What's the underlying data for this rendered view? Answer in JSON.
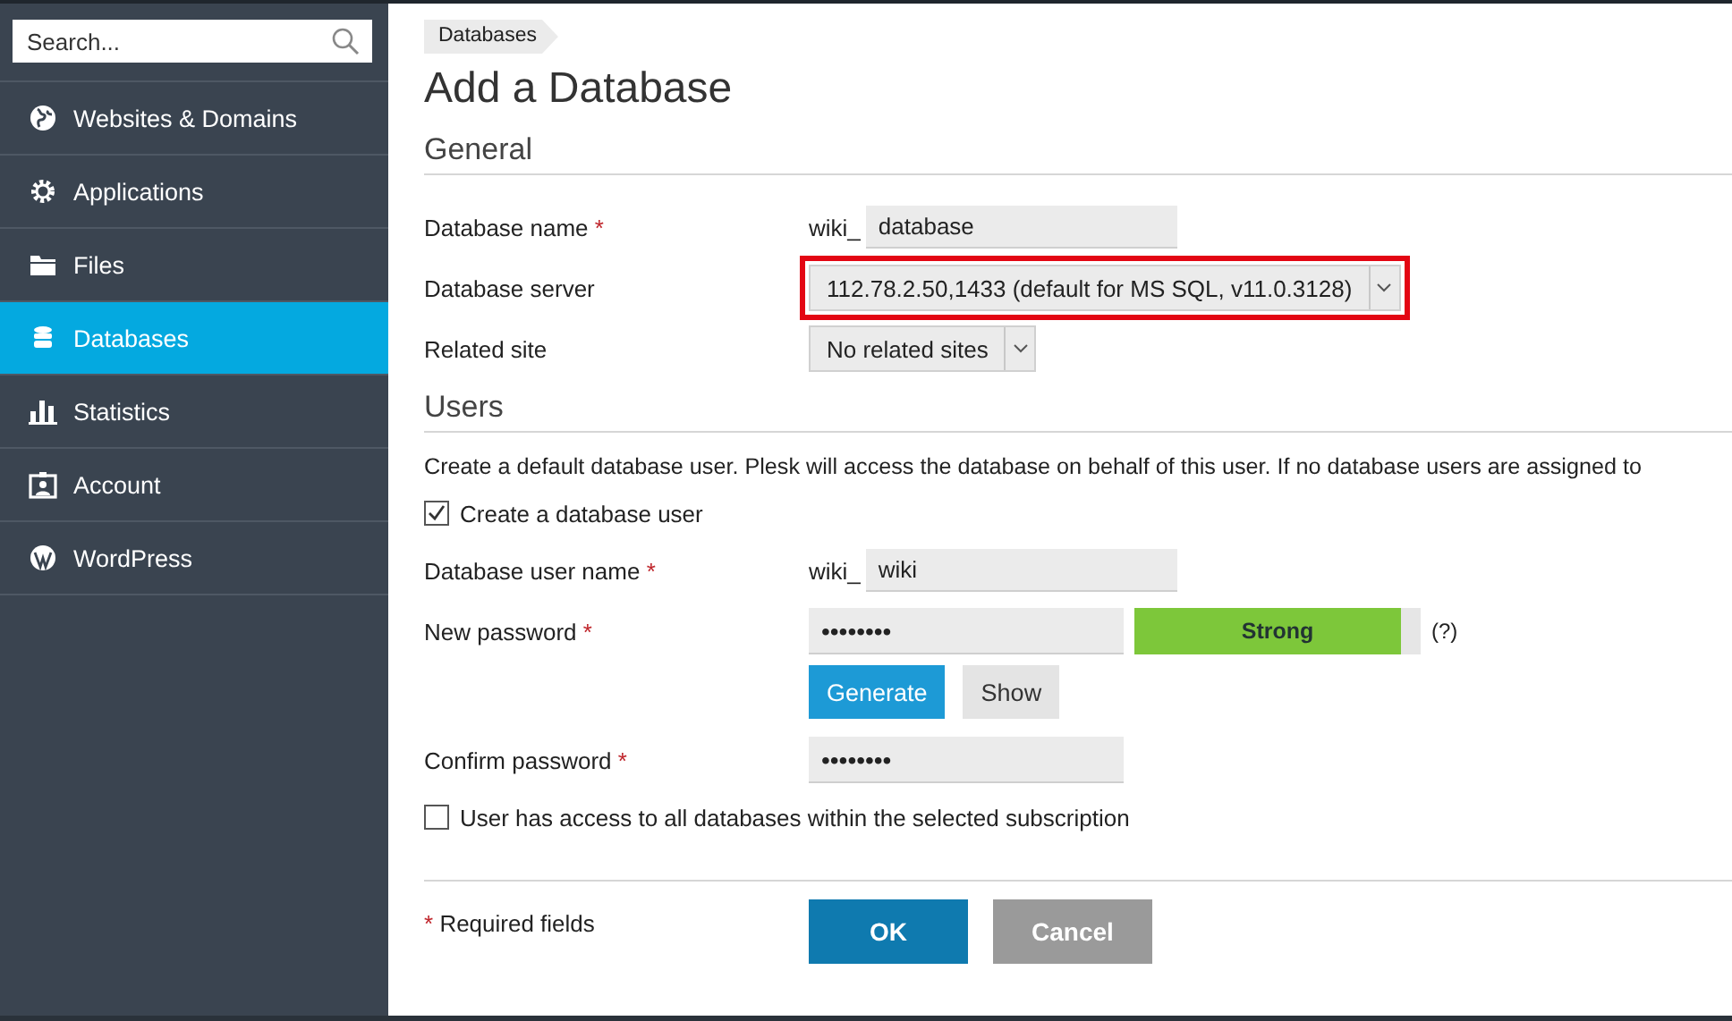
{
  "sidebar": {
    "search": {
      "placeholder": "Search..."
    },
    "items": [
      {
        "label": "Websites & Domains",
        "selected": false
      },
      {
        "label": "Applications",
        "selected": false
      },
      {
        "label": "Files",
        "selected": false
      },
      {
        "label": "Databases",
        "selected": true
      },
      {
        "label": "Statistics",
        "selected": false
      },
      {
        "label": "Account",
        "selected": false
      },
      {
        "label": "WordPress",
        "selected": false
      }
    ]
  },
  "breadcrumb": [
    "Databases"
  ],
  "title": "Add a Database",
  "sections": [
    {
      "title": "General",
      "rows": [
        {
          "kind": "text",
          "label": "Database name",
          "required": true,
          "prefix": "wiki_",
          "value": "database"
        },
        {
          "kind": "select",
          "label": "Database server",
          "value": "112.78.2.50,1433 (default for MS SQL, v11.0.3128)",
          "highlighted": true
        },
        {
          "kind": "select",
          "label": "Related site",
          "value": "No related sites",
          "highlighted": false
        }
      ]
    },
    {
      "title": "Users",
      "description": "Create a default database user. Plesk will access the database on behalf of this user. If no database users are assigned to",
      "rows": [
        {
          "kind": "checkbox",
          "label": "Create a database user",
          "checked": true
        },
        {
          "kind": "text",
          "label": "Database user name",
          "required": true,
          "prefix": "wiki_",
          "value": "wiki"
        },
        {
          "kind": "password",
          "label": "New password",
          "required": true,
          "value": "••••••••",
          "strength": {
            "label": "Strong",
            "level": 0.93
          },
          "help": "(?)",
          "actions": [
            {
              "label": "Generate",
              "kind": "primary"
            },
            {
              "label": "Show",
              "kind": "secondary"
            }
          ]
        },
        {
          "kind": "password",
          "label": "Confirm password",
          "required": true,
          "value": "••••••••"
        },
        {
          "kind": "checkbox",
          "label": "User has access to all databases within the selected subscription",
          "checked": false
        }
      ]
    }
  ],
  "required_note": {
    "mark": "*",
    "text": "Required fields"
  },
  "buttons": [
    {
      "label": "OK",
      "kind": "primary"
    },
    {
      "label": "Cancel",
      "kind": "secondary"
    }
  ]
}
